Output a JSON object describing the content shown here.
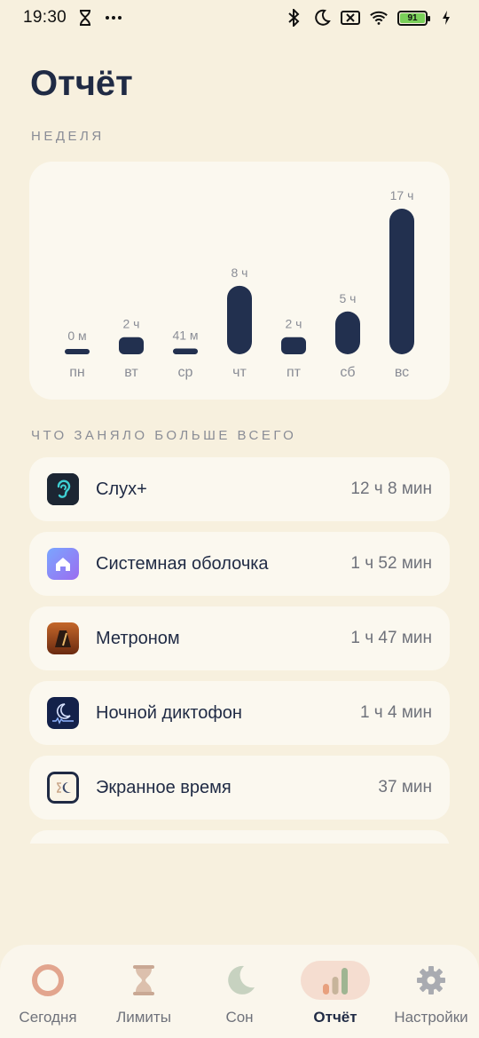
{
  "status_bar": {
    "time": "19:30",
    "battery": "91",
    "left_icons": [
      "hourglass-icon",
      "more-dots-icon"
    ],
    "right_icons": [
      "bluetooth-icon",
      "moon-icon",
      "sim-off-icon",
      "wifi-icon",
      "battery-icon",
      "charging-icon"
    ]
  },
  "page": {
    "title": "Отчёт",
    "week_label": "НЕДЕЛЯ",
    "top_label": "ЧТО ЗАНЯЛО БОЛЬШЕ ВСЕГО"
  },
  "chart_data": {
    "type": "bar",
    "categories": [
      "пн",
      "вт",
      "ср",
      "чт",
      "пт",
      "сб",
      "вс"
    ],
    "value_labels": [
      "0 м",
      "2 ч",
      "41 м",
      "8 ч",
      "2 ч",
      "5 ч",
      "17 ч"
    ],
    "values_hours": [
      0,
      2,
      0.68,
      8,
      2,
      5,
      17
    ],
    "bar_color": "#22304f",
    "label_color": "#8a8d96"
  },
  "apps": [
    {
      "name": "Слух+",
      "time": "12 ч 8 мин",
      "icon": "ear-icon"
    },
    {
      "name": "Системная оболочка",
      "time": "1 ч 52 мин",
      "icon": "home-icon"
    },
    {
      "name": "Метроном",
      "time": "1 ч 47 мин",
      "icon": "metronome-icon"
    },
    {
      "name": "Ночной диктофон",
      "time": "1 ч 4 мин",
      "icon": "night-recorder-icon"
    },
    {
      "name": "Экранное время",
      "time": "37 мин",
      "icon": "screen-time-icon"
    }
  ],
  "nav": [
    {
      "label": "Сегодня",
      "icon": "ring-icon",
      "active": false
    },
    {
      "label": "Лимиты",
      "icon": "hourglass-icon",
      "active": false
    },
    {
      "label": "Сон",
      "icon": "moon-icon",
      "active": false
    },
    {
      "label": "Отчёт",
      "icon": "bar-chart-icon",
      "active": true
    },
    {
      "label": "Настройки",
      "icon": "gear-icon",
      "active": false
    }
  ],
  "colors": {
    "background": "#f7f0de",
    "card": "#fbf8ef",
    "primary_text": "#1f2a44",
    "accent_active_nav": "#f5ddd0"
  }
}
